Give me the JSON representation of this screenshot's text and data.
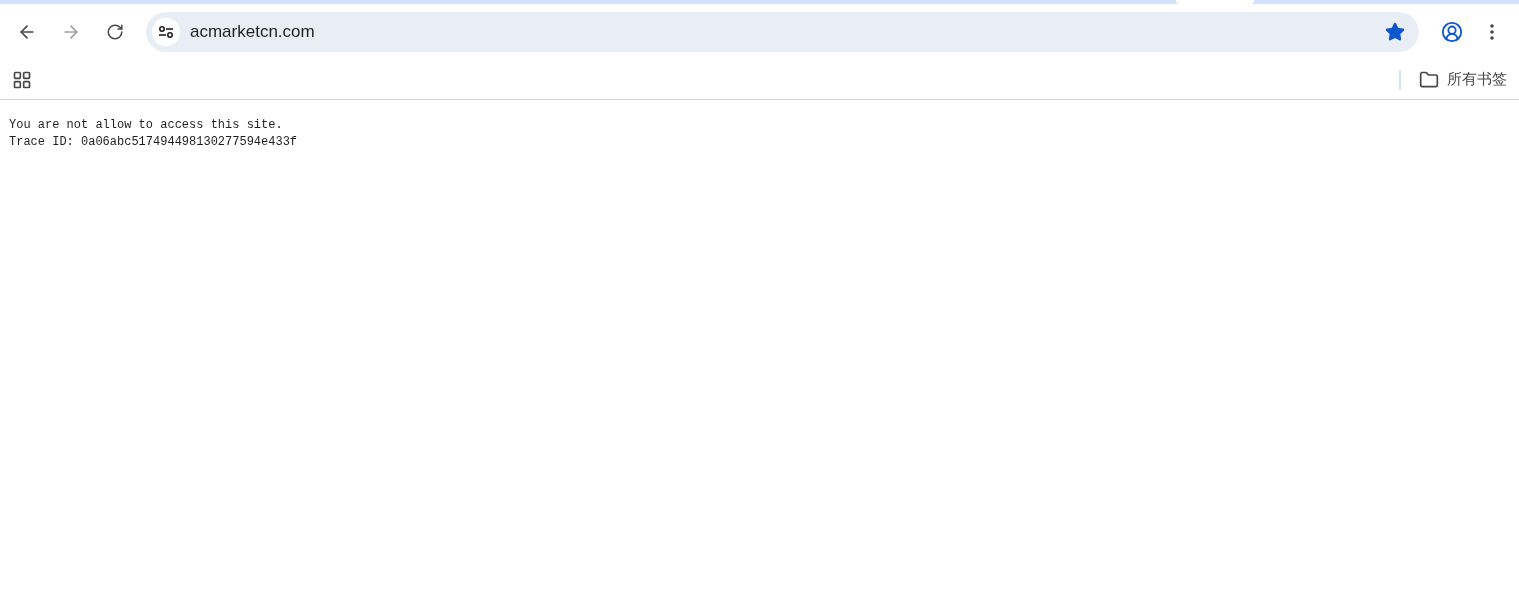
{
  "toolbar": {
    "back": {
      "disabled": false
    },
    "forward": {
      "disabled": true
    },
    "address": "acmarketcn.com",
    "bookmarked": true
  },
  "bookmarks_bar": {
    "all_bookmarks": "所有书签"
  },
  "page": {
    "lines": [
      "You are not allow to access this site.",
      "Trace ID: 0a06abc517494498130277594e433f"
    ]
  }
}
